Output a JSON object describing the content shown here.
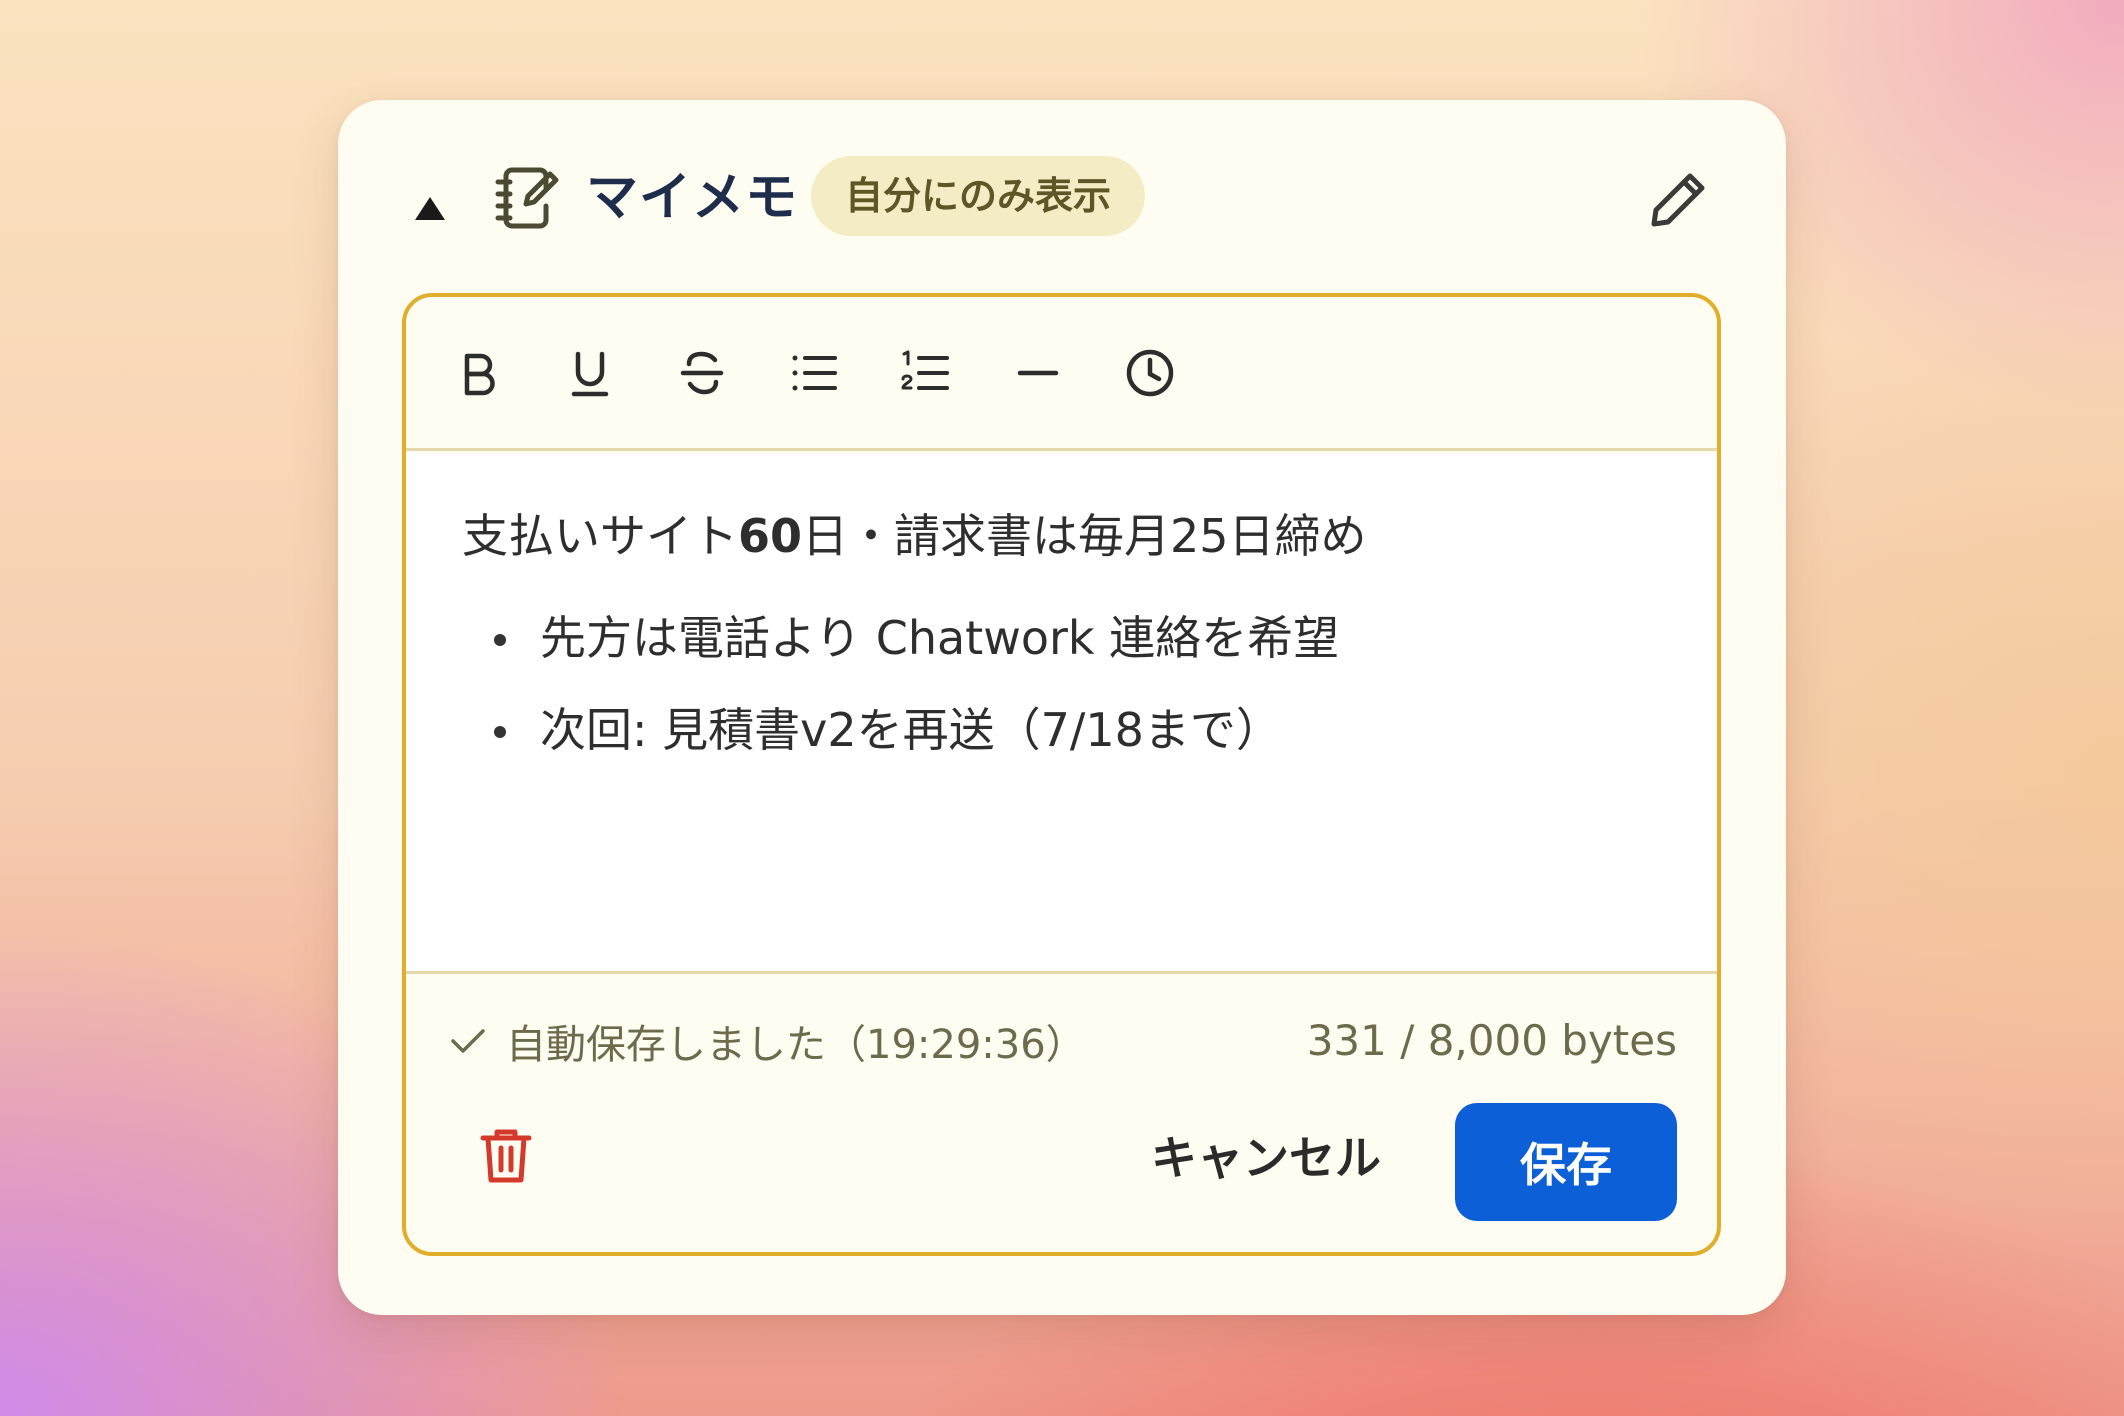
{
  "header": {
    "title": "マイメモ",
    "badge": "自分にのみ表示",
    "collapse_icon": "triangle-up-icon",
    "memo_icon": "notebook-pen-icon",
    "edit_icon": "pencil-icon"
  },
  "toolbar": {
    "bold_label": "B",
    "items": [
      "bold",
      "underline",
      "strikethrough",
      "bullet-list",
      "numbered-list",
      "horizontal-rule",
      "timestamp"
    ]
  },
  "content": {
    "line1_prefix": "支払いサイト",
    "line1_bold": "60",
    "line1_suffix": "日・請求書は毎月25日締め",
    "bullets": [
      "先方は電話より Chatwork 連絡を希望",
      "次回: 見積書v2を再送（7/18まで）"
    ]
  },
  "footer": {
    "status": "自動保存しました（19:29:36）",
    "bytes": "331 / 8,000 bytes",
    "cancel_label": "キャンセル",
    "save_label": "保存"
  },
  "colors": {
    "accent": "#e0ae2a",
    "primary": "#0d5fd8",
    "danger": "#d33a2c",
    "title": "#1f2d4d"
  }
}
